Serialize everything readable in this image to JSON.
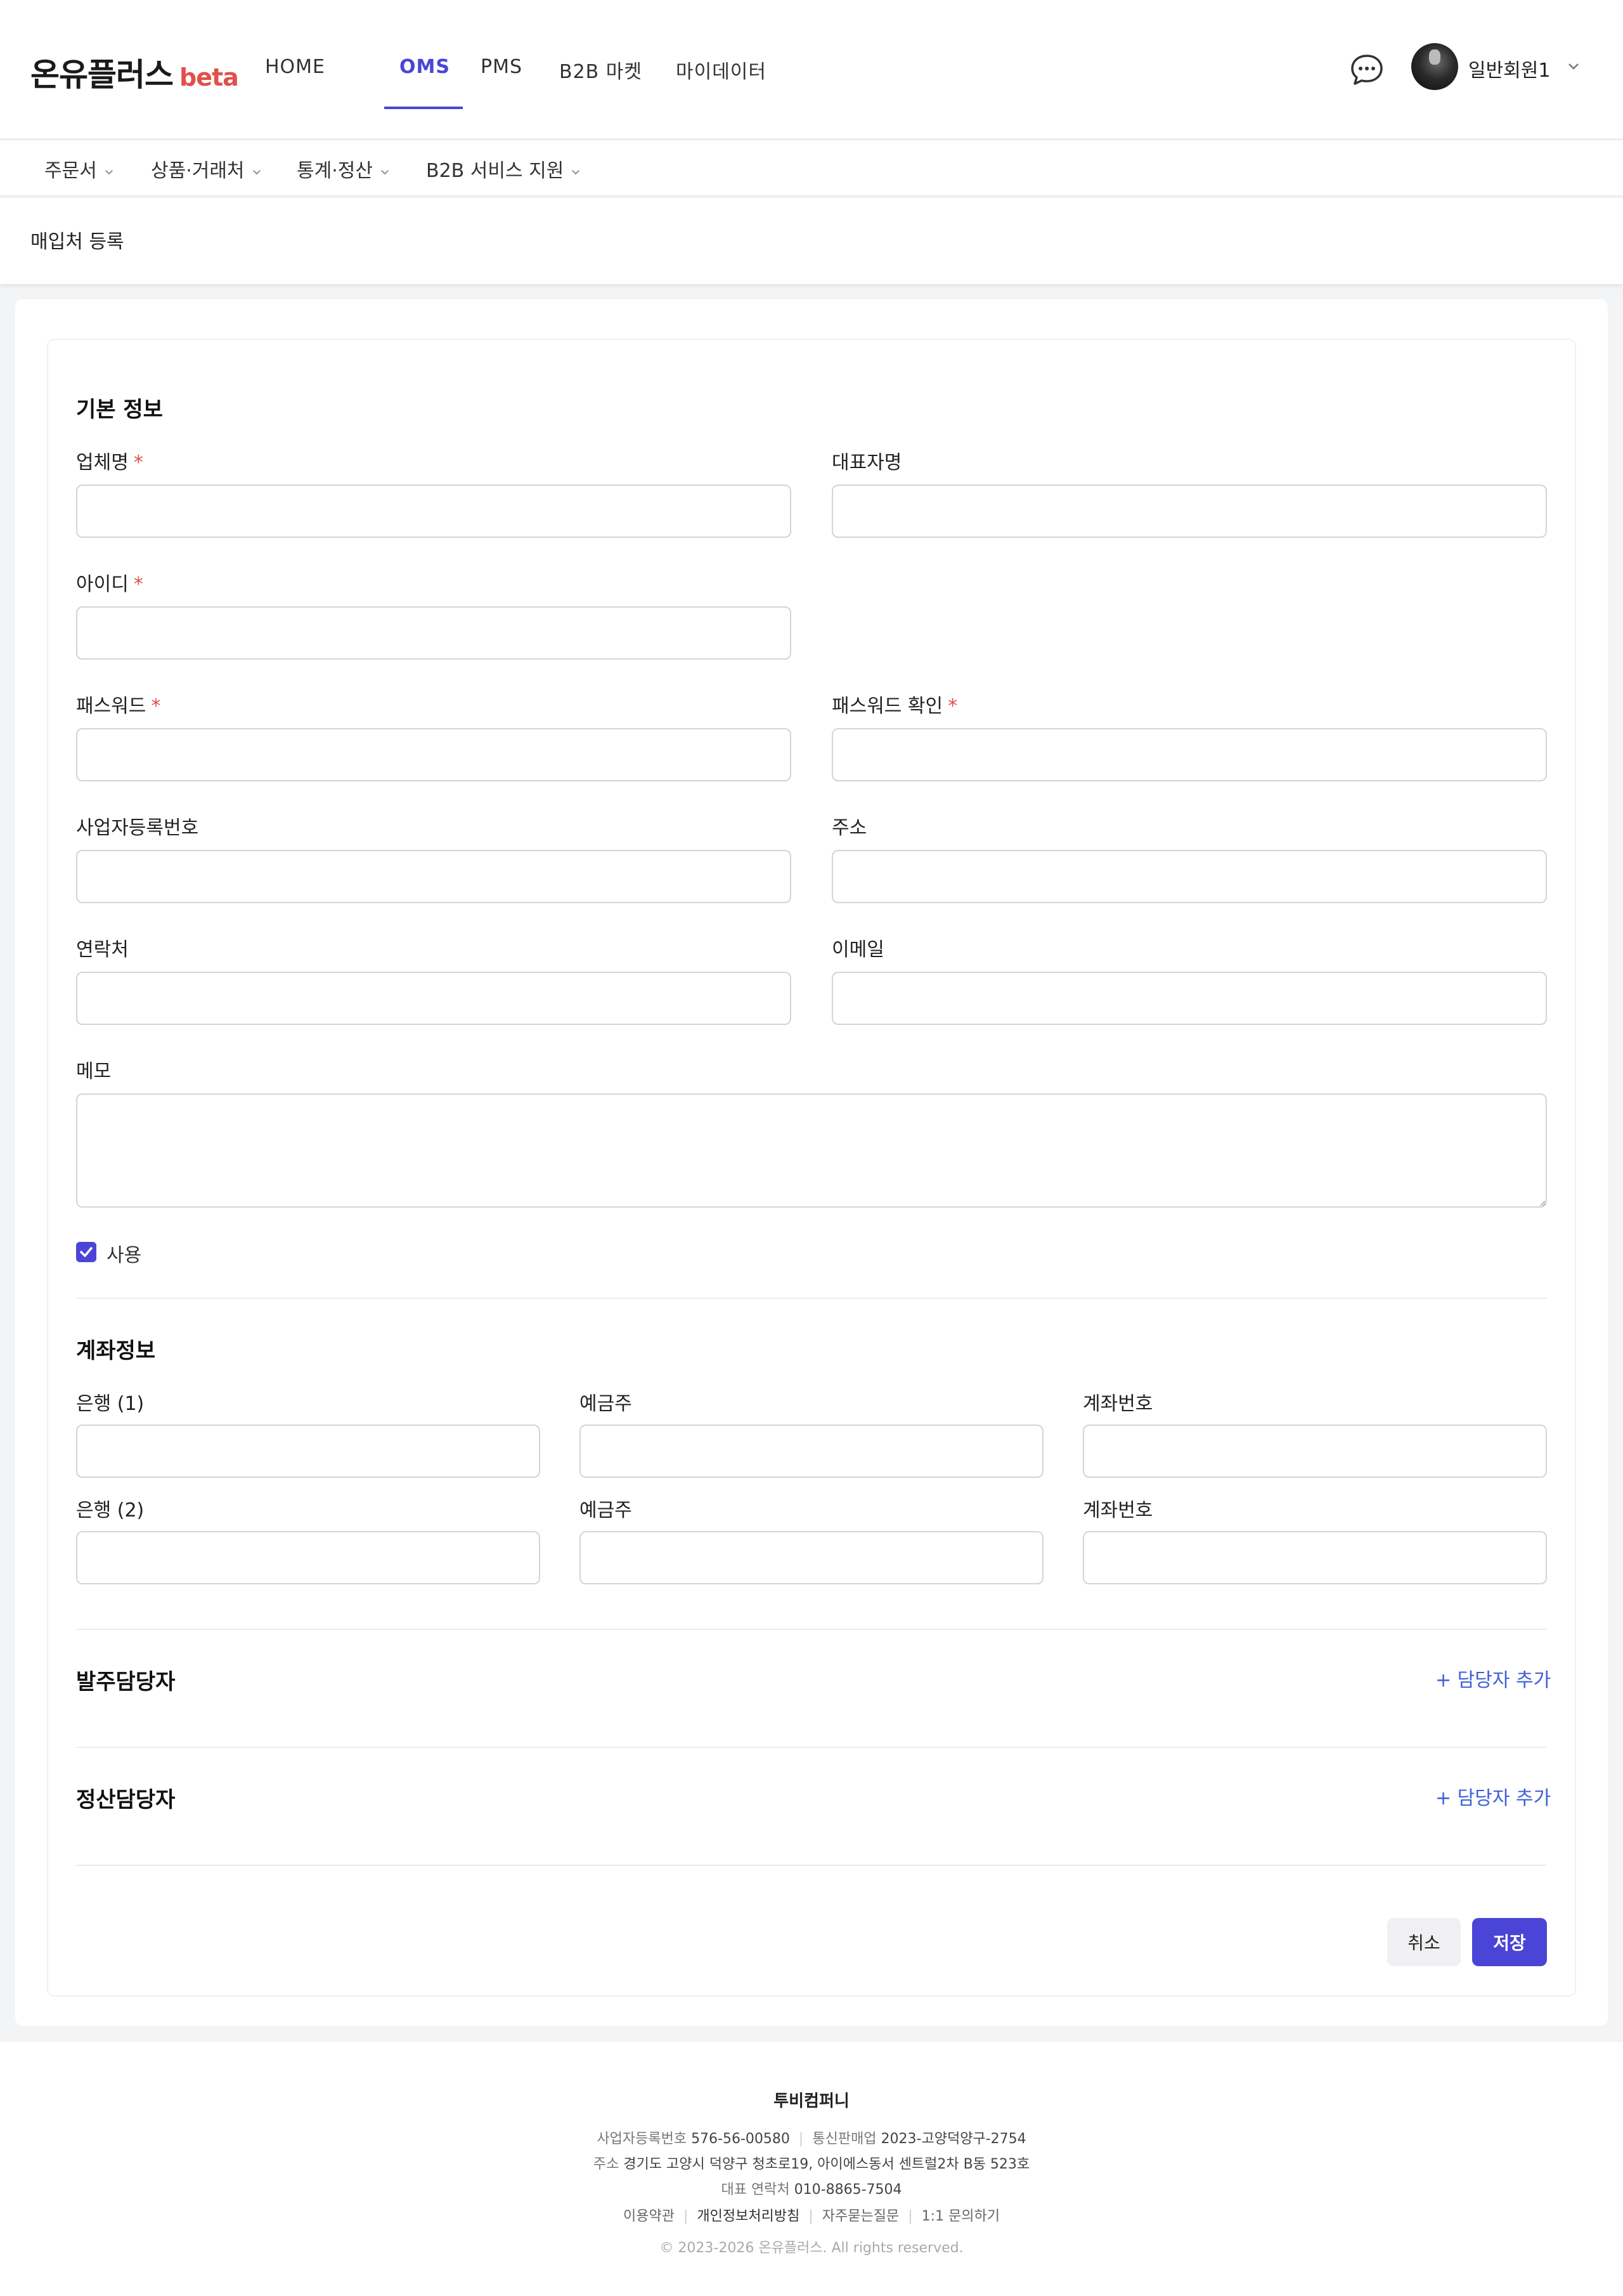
{
  "header": {
    "logo": "온유플러스",
    "logo_badge": "beta",
    "nav": [
      {
        "label": "HOME"
      },
      {
        "label": "OMS"
      },
      {
        "label": "PMS"
      },
      {
        "label": "B2B 마켓"
      },
      {
        "label": "마이데이터"
      }
    ],
    "active_nav": "OMS",
    "username": "일반회원1"
  },
  "subnav": [
    {
      "label": "주문서"
    },
    {
      "label": "상품·거래처"
    },
    {
      "label": "통계·정산"
    },
    {
      "label": "B2B 서비스 지원"
    }
  ],
  "page": {
    "title": "매입처 등록"
  },
  "form": {
    "basic_title": "기본 정보",
    "company_name_label": "업체명",
    "ceo_name_label": "대표자명",
    "id_label": "아이디",
    "password_label": "패스워드",
    "password_confirm_label": "패스워드 확인",
    "biz_number_label": "사업자등록번호",
    "address_label": "주소",
    "phone_label": "연락처",
    "email_label": "이메일",
    "memo_label": "메모",
    "use_label": "사용",
    "use_checked": true,
    "required_mark": "*",
    "account_title": "계좌정보",
    "bank1_label": "은행 (1)",
    "bank2_label": "은행 (2)",
    "holder_label": "예금주",
    "account_no_label": "계좌번호",
    "order_manager_title": "발주담당자",
    "settle_manager_title": "정산담당자",
    "add_manager_label": "+ 담당자 추가",
    "cancel_label": "취소",
    "save_label": "저장"
  },
  "footer": {
    "company": "투비컴퍼니",
    "biz_number_label": "사업자등록번호",
    "biz_number": "576-56-00580",
    "ecommerce_label": "통신판매업",
    "ecommerce": "2023-고양덕양구-2754",
    "address_label": "주소",
    "address": "경기도 고양시 덕양구 청초로19, 아이에스동서 센트럴2차 B동 523호",
    "phone_label": "대표 연락처",
    "phone": "010-8865-7504",
    "links": [
      "이용약관",
      "개인정보처리방침",
      "자주묻는질문",
      "1:1 문의하기"
    ],
    "copyright": "© 2023-2026 온유플러스. All rights reserved."
  },
  "colors": {
    "accent": "#4a45d6",
    "required": "#e0504a",
    "link": "#3f5fd9"
  }
}
